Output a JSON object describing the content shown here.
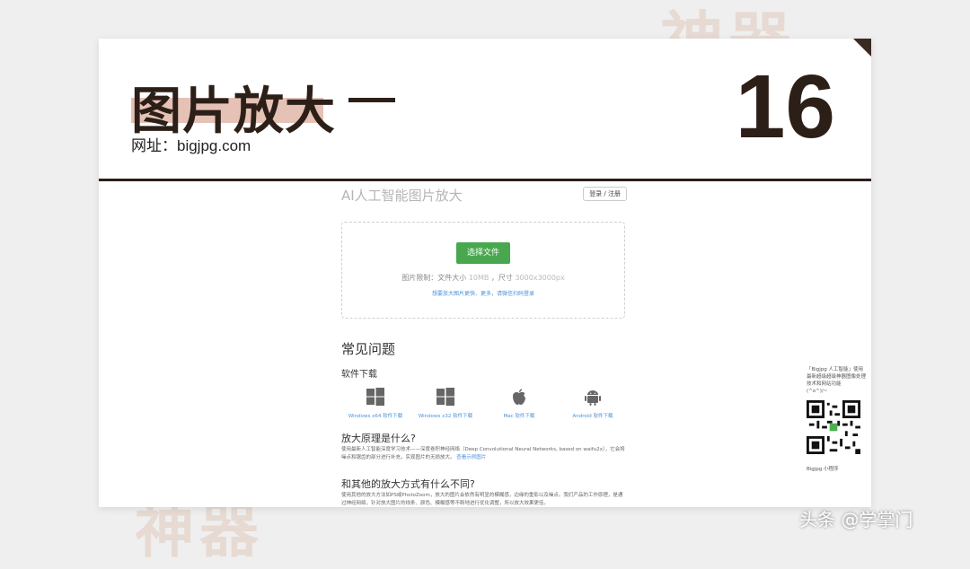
{
  "background": {
    "deco_top": "神器",
    "deco_bottom": "神器"
  },
  "slide": {
    "title": "图片放大",
    "url_line": "网址：bigjpg.com",
    "number": "16"
  },
  "site": {
    "title": "AI人工智能图片放大",
    "login_label": "登录 / 注册",
    "select_label": "选择文件",
    "limit_prefix": "图片限制：文件大小",
    "limit_size": "10MB",
    "limit_sep": "，尺寸",
    "limit_dims": "3000x3000px",
    "upload_tip": "想要放大图片更快、更多，请微信扫码登录",
    "faq_title": "常见问题",
    "download_title": "软件下载",
    "downloads": [
      {
        "label": "Windows x64 软件下载",
        "icon": "windows-icon"
      },
      {
        "label": "Windows x32 软件下载",
        "icon": "windows-icon"
      },
      {
        "label": "Mac 软件下载",
        "icon": "apple-icon"
      },
      {
        "label": "Android 软件下载",
        "icon": "android-icon"
      }
    ],
    "q1": "放大原理是什么?",
    "p1_text": "使用最新人工智能深度学习技术——深度卷积神经网络（Deep Convolutional Neural Networks, based on waifu2x），它会将噪点和锯齿的部分进行补充，实现图片的无损放大。",
    "p1_link": "查看示例图片",
    "q2": "和其他的放大方式有什么不同?",
    "p2_text": "使用其他的放大方法如PS或PhotoZoom，放大的图片会依然有明显的模糊感，边缘的重影以及噪点。我们产品的工作原理，是通过神经网络，针对放大图片的线条、颜色、模糊感等不断地进行优化调整，所以放大效果更佳。"
  },
  "sidebar": {
    "text": "「Bigjpg 人工智能」使用最新超级超级神器图像处理技术和网站功能",
    "code": "(^o^)/~",
    "bottom_label": "Bigjpg 小程序"
  },
  "watermark": "头条 @学掌门",
  "colors": {
    "accent_dark": "#2c1f18",
    "highlight": "#e0b7a8",
    "button_green": "#49a84f",
    "link_blue": "#4a90d9"
  }
}
